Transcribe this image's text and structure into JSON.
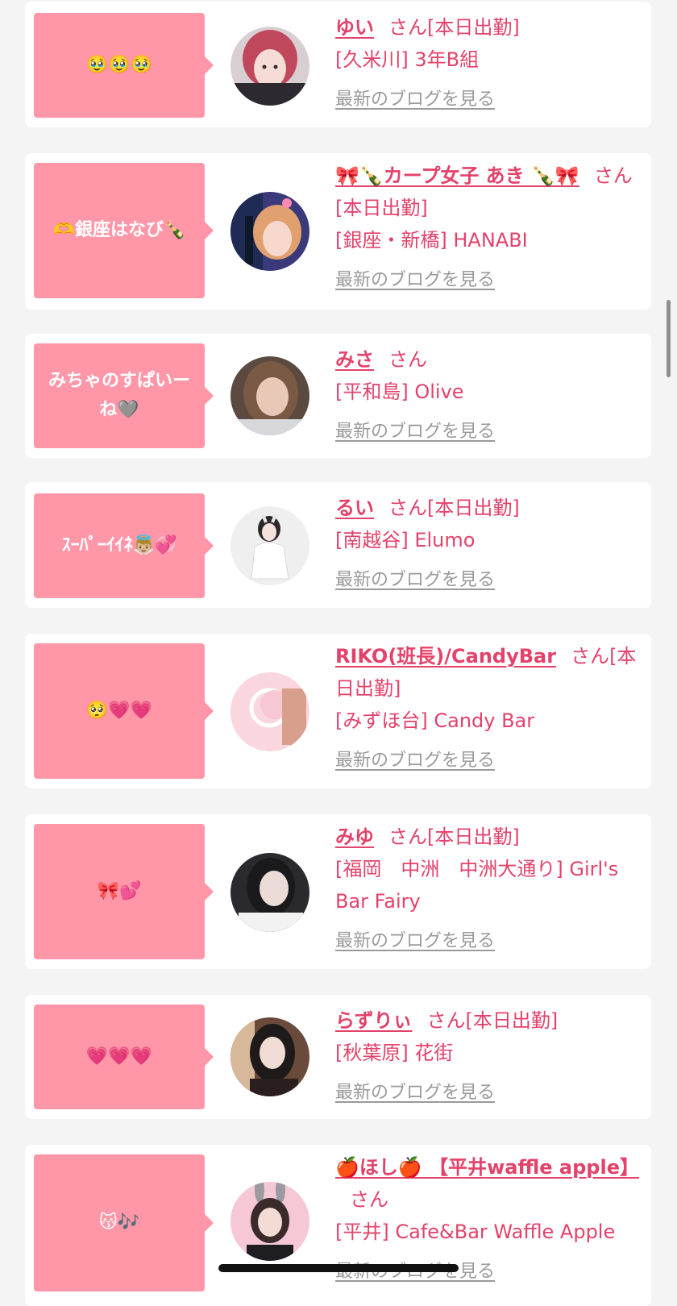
{
  "colors": {
    "bubble": "#ff97a9",
    "accent": "#e3426a",
    "muted": "#9a9a9a",
    "background": "#f4f4f4"
  },
  "blog_link_label": "最新のブログを見る",
  "entries": [
    {
      "comment": "🥹🥹🥹",
      "name": "ゆい",
      "san": "さん[本日出勤]",
      "shop": "[久米川] 3年B組",
      "avatar_icon": "woman-pink-hair-photo"
    },
    {
      "comment": "🫶銀座はなび🍾",
      "name": "🎀🍾カープ女子 あき 🍾🎀",
      "san": "さん[本日出勤]",
      "shop": "[銀座・新橋] HANABI",
      "avatar_icon": "woman-party-photo"
    },
    {
      "comment": "みちゃのすぱいーね🩶",
      "name": "みさ",
      "san": "さん",
      "shop": "[平和島] Olive",
      "avatar_icon": "woman-selfie-photo"
    },
    {
      "comment": "ｽｰﾊﾟｰｲｲﾈ👼🏼💞",
      "name": "るい",
      "san": "さん[本日出勤]",
      "shop": "[南越谷] Elumo",
      "avatar_icon": "woman-white-dress-photo"
    },
    {
      "comment": "🥺💗💗",
      "name": "RIKO(班長)/CandyBar",
      "san": "さん[本日出勤]",
      "shop": "[みずほ台] Candy Bar",
      "avatar_icon": "candy-bar-logo-photo"
    },
    {
      "comment": "🎀💕",
      "name": "みゆ",
      "san": "さん[本日出勤]",
      "shop": "[福岡　中洲　中洲大通り] Girl's Bar Fairy",
      "avatar_icon": "woman-dark-photo"
    },
    {
      "comment": "💗💗💗",
      "name": "らずりぃ",
      "san": "さん[本日出勤]",
      "shop": "[秋葉原] 花街",
      "avatar_icon": "woman-kimono-photo"
    },
    {
      "comment": "😽🎶",
      "name": "🍎ほし🍎 【平井waffle apple】",
      "san": "さん",
      "shop": "[平井] Cafe&Bar Waffle Apple",
      "avatar_icon": "woman-bunny-ears-photo"
    }
  ]
}
